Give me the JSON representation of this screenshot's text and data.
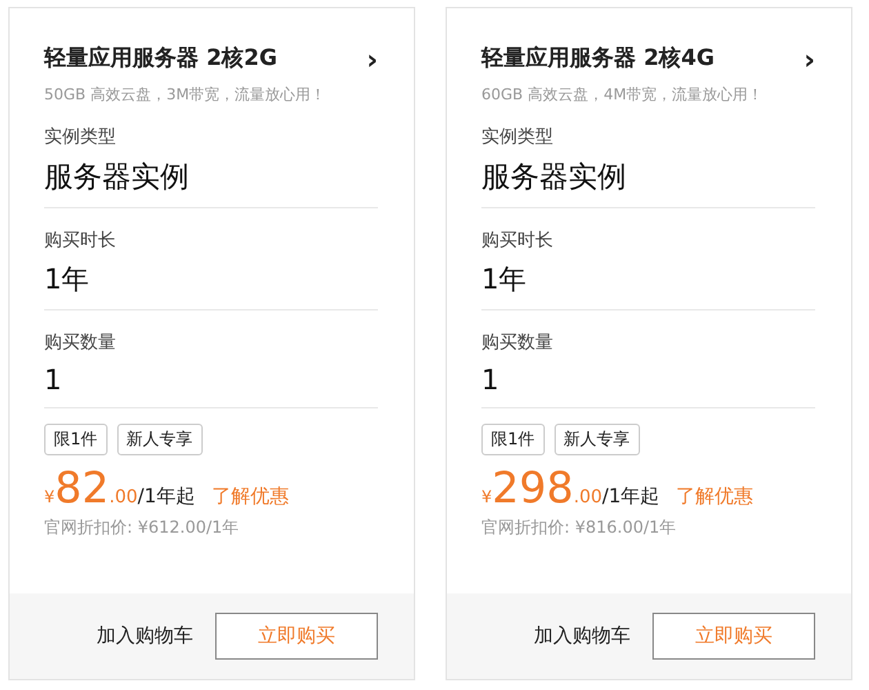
{
  "products": [
    {
      "title": "轻量应用服务器 2核2G",
      "chevron": "›",
      "subtitle": "50GB 高效云盘，3M带宽，流量放心用！",
      "fields": [
        {
          "label": "实例类型",
          "value": "服务器实例",
          "kind": "large"
        },
        {
          "label": "购买时长",
          "value": "1年",
          "kind": "medium"
        },
        {
          "label": "购买数量",
          "value": "1",
          "kind": "medium"
        }
      ],
      "tags": [
        "限1件",
        "新人专享"
      ],
      "price": {
        "currency": "¥",
        "integer": "82",
        "decimal": ".00",
        "unit": "/1年起"
      },
      "offer_link": "了解优惠",
      "list_price": "官网折扣价: ¥612.00/1年",
      "cart_button": "加入购物车",
      "buy_button": "立即购买"
    },
    {
      "title": "轻量应用服务器 2核4G",
      "chevron": "›",
      "subtitle": "60GB 高效云盘，4M带宽，流量放心用！",
      "fields": [
        {
          "label": "实例类型",
          "value": "服务器实例",
          "kind": "large"
        },
        {
          "label": "购买时长",
          "value": "1年",
          "kind": "medium"
        },
        {
          "label": "购买数量",
          "value": "1",
          "kind": "medium"
        }
      ],
      "tags": [
        "限1件",
        "新人专享"
      ],
      "price": {
        "currency": "¥",
        "integer": "298",
        "decimal": ".00",
        "unit": "/1年起"
      },
      "offer_link": "了解优惠",
      "list_price": "官网折扣价: ¥816.00/1年",
      "cart_button": "加入购物车",
      "buy_button": "立即购买"
    }
  ]
}
